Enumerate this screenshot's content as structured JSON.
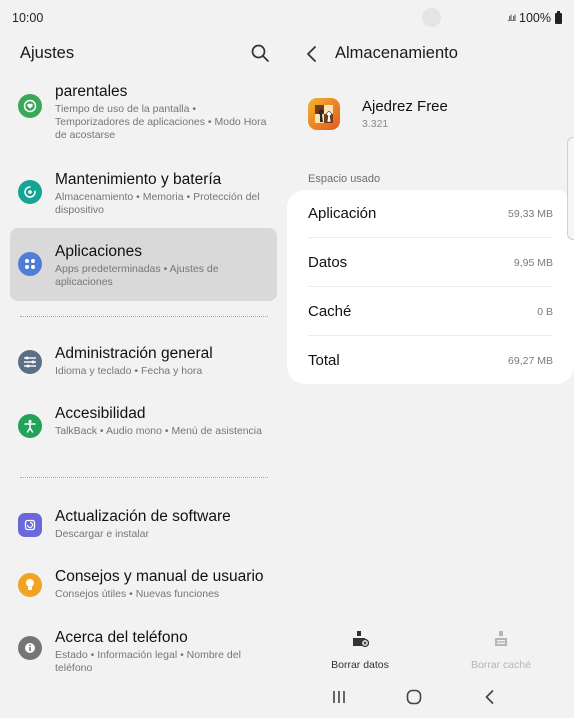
{
  "status_bar": {
    "time": "10:00",
    "battery": "100%"
  },
  "left": {
    "title": "Ajustes",
    "items": [
      {
        "title": "parentales",
        "subtitle": "Tiempo de uso de la pantalla  •  Temporizadores de aplicaciones  •  Modo Hora de acostarse",
        "icon": "parental-controls-icon",
        "color": "#3aa859"
      },
      {
        "title": "Mantenimiento y batería",
        "subtitle": "Almacenamiento  •  Memoria  •  Protección del dispositivo",
        "icon": "device-care-icon",
        "color": "#16a494"
      },
      {
        "title": "Aplicaciones",
        "subtitle": "Apps predeterminadas  •  Ajustes de aplicaciones",
        "icon": "apps-icon",
        "color": "#4f7dd8"
      },
      {
        "title": "Administración general",
        "subtitle": "Idioma y teclado  •  Fecha y hora",
        "icon": "general-management-icon",
        "color": "#5b6f86"
      },
      {
        "title": "Accesibilidad",
        "subtitle": "TalkBack  •  Audio mono  •  Menú de asistencia",
        "icon": "accessibility-icon",
        "color": "#23a25a"
      },
      {
        "title": "Actualización de software",
        "subtitle": "Descargar e instalar",
        "icon": "software-update-icon",
        "color": "#6a69dc"
      },
      {
        "title": "Consejos y manual de usuario",
        "subtitle": "Consejos útiles  •  Nuevas funciones",
        "icon": "tips-icon",
        "color": "#f2a323"
      },
      {
        "title": "Acerca del teléfono",
        "subtitle": "Estado  •  Información legal  •  Nombre del teléfono",
        "icon": "about-phone-icon",
        "color": "#757575"
      }
    ]
  },
  "right": {
    "title": "Almacenamiento",
    "app": {
      "name": "Ajedrez Free",
      "version": "3.321"
    },
    "section_label": "Espacio usado",
    "rows": [
      {
        "label": "Aplicación",
        "value": "59,33 MB"
      },
      {
        "label": "Datos",
        "value": "9,95 MB"
      },
      {
        "label": "Caché",
        "value": "0 B"
      },
      {
        "label": "Total",
        "value": "69,27 MB"
      }
    ],
    "actions": {
      "clear_data": "Borrar datos",
      "clear_cache": "Borrar caché"
    }
  }
}
